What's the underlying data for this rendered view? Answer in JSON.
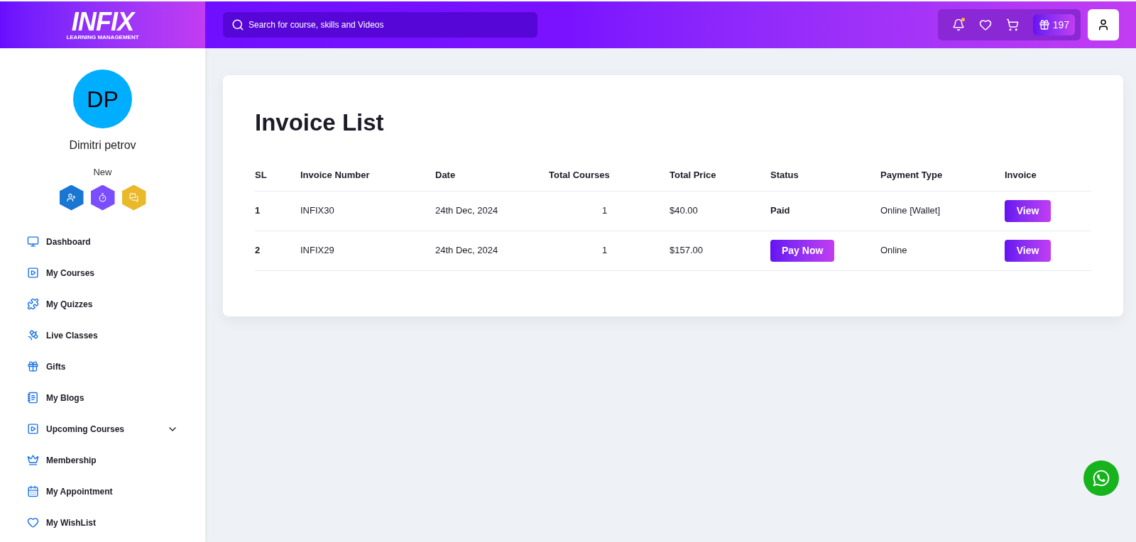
{
  "header": {
    "logo": {
      "title": "INFIX",
      "subtitle": "LEARNING MANAGEMENT"
    },
    "search": {
      "placeholder": "Search for course, skills and Videos"
    },
    "notification_dot": true,
    "gift_count": "197"
  },
  "profile": {
    "initials": "DP",
    "name": "Dimitri petrov",
    "level": "New",
    "badges": [
      {
        "color": "#1976d2"
      },
      {
        "color": "#7c4dff"
      },
      {
        "color": "#e9b92a"
      }
    ]
  },
  "sidebar": {
    "items": [
      {
        "label": "Dashboard"
      },
      {
        "label": "My Courses"
      },
      {
        "label": "My Quizzes"
      },
      {
        "label": "Live Classes"
      },
      {
        "label": "Gifts"
      },
      {
        "label": "My Blogs"
      },
      {
        "label": "Upcoming Courses",
        "expanded": false
      },
      {
        "label": "Membership"
      },
      {
        "label": "My Appointment"
      },
      {
        "label": "My WishList"
      }
    ]
  },
  "invoices": {
    "title": "Invoice List",
    "columns": [
      "SL",
      "Invoice Number",
      "Date",
      "Total Courses",
      "Total Price",
      "Status",
      "Payment Type",
      "Invoice"
    ],
    "rows": [
      {
        "sl": "1",
        "number": "INFIX30",
        "date": "24th Dec, 2024",
        "courses": "1",
        "price": "$40.00",
        "status": {
          "kind": "text",
          "label": "Paid"
        },
        "payment": "Online [Wallet]",
        "action": "View"
      },
      {
        "sl": "2",
        "number": "INFIX29",
        "date": "24th Dec, 2024",
        "courses": "1",
        "price": "$157.00",
        "status": {
          "kind": "button",
          "label": "Pay Now"
        },
        "payment": "Online",
        "action": "View"
      }
    ]
  }
}
